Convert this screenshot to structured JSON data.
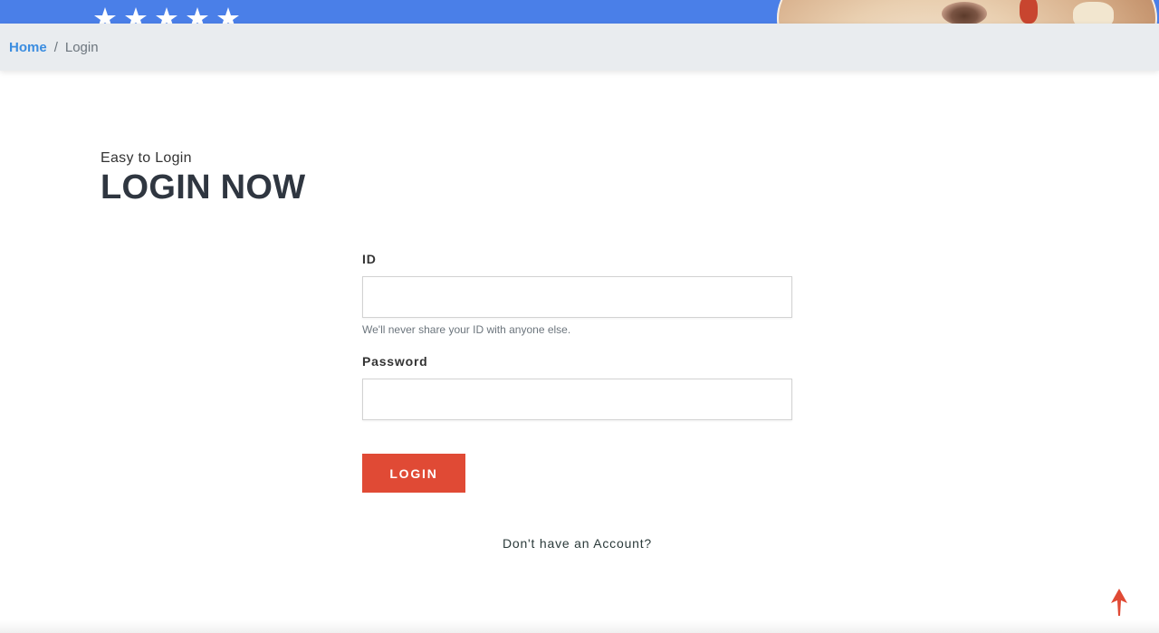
{
  "banner": {
    "stars_count": 5
  },
  "breadcrumb": {
    "home": "Home",
    "separator": "/",
    "current": "Login"
  },
  "heading": {
    "eyebrow": "Easy to Login",
    "title": "LOGIN NOW"
  },
  "form": {
    "id_label": "ID",
    "id_value": "",
    "id_help": "We'll never share your ID with anyone else.",
    "password_label": "Password",
    "password_value": "",
    "login_button": "LOGIN",
    "account_link": "Don't have an Account?"
  },
  "icons": {
    "back_to_top": "arrow-up-icon"
  },
  "colors": {
    "banner": "#4a7fe8",
    "link": "#3b8de0",
    "button": "#e04a35",
    "arrow": "#e04a35",
    "crumb_bar": "#e9ecef"
  }
}
